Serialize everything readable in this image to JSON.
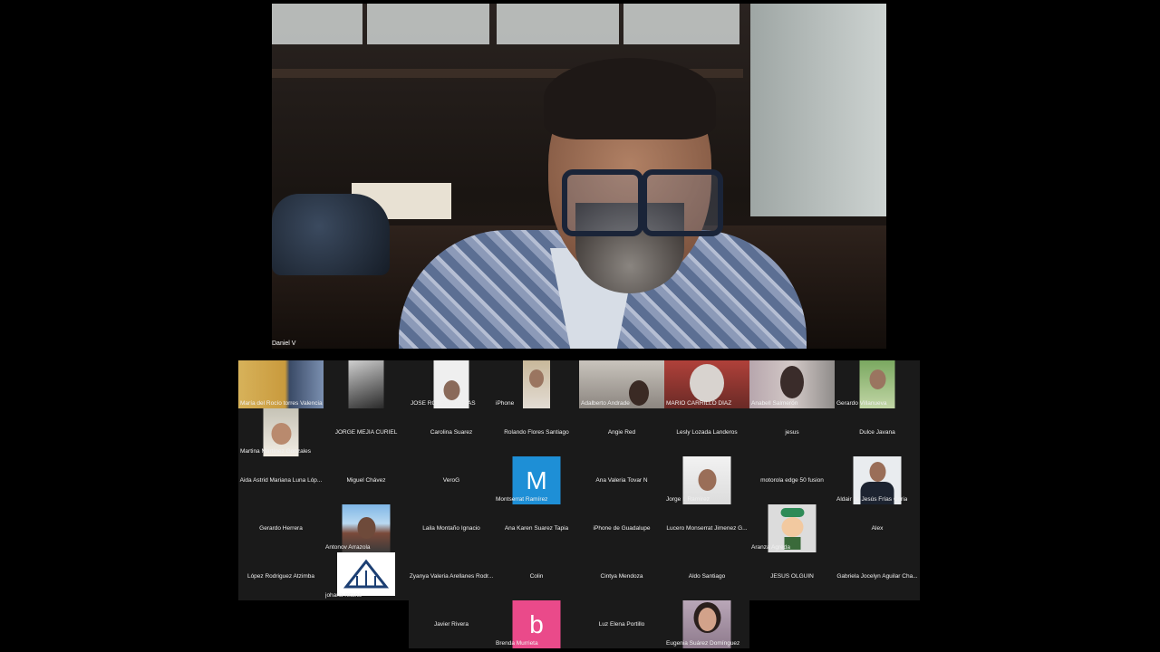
{
  "speaker": {
    "name": "Daniel V"
  },
  "participants": [
    "María del Rocío torres Valencia",
    "",
    "JOSE ROBERTO ARIAS",
    "iPhone",
    "Adalberto Andrade",
    "MARIO CARRILLO DÍAZ",
    "Anabell Salmerón",
    "Gerardo Villanueva",
    "Martina Martínez Gonzales",
    "JORGE MEJIA CURIEL",
    "Carolina Suarez",
    "Rolando Flores Santiago",
    "Angie Red",
    "Lesly Lozada Landeros",
    "jesus",
    "Dulce Javana",
    "Aida Astrid Mariana Luna Lóp...",
    "Miguel Chávez",
    "VeroG",
    "Montserrat Ramírez",
    "Ana Valeria Tovar N",
    "Jorge I. Ramírez",
    "motorola edge 50 fusion",
    "Aldair de Jesús Frías Coria",
    "Gerardo Herrera",
    "Antonov Arrazola",
    "Laila Montaño Ignacio",
    "Ana Karen Suarez Tapia",
    "iPhone de Guadalupe",
    "Lucero Monserrat Jimenez G...",
    "Aranza Agreda",
    "Alex",
    "López Rodriguez Atzimba",
    "johana retana",
    "Zyanya Valeria Arellanes Rodr...",
    "Colin",
    "Cintya Mendoza",
    "Aldo Santiago",
    "JESUS OLGUIN",
    "Gabriela Jocelyn Aguilar Cha..."
  ],
  "bottom_participants": [
    "Javier Rivera",
    "Brenda Murrieta",
    "Luz Elena Portillo",
    "Eugenia Suárez Domínguez"
  ],
  "avatars": {
    "montserrat_letter": "M",
    "brenda_letter": "b"
  },
  "colors": {
    "montserrat_avatar": "#1e8fd6",
    "brenda_avatar": "#ea4a8a"
  }
}
